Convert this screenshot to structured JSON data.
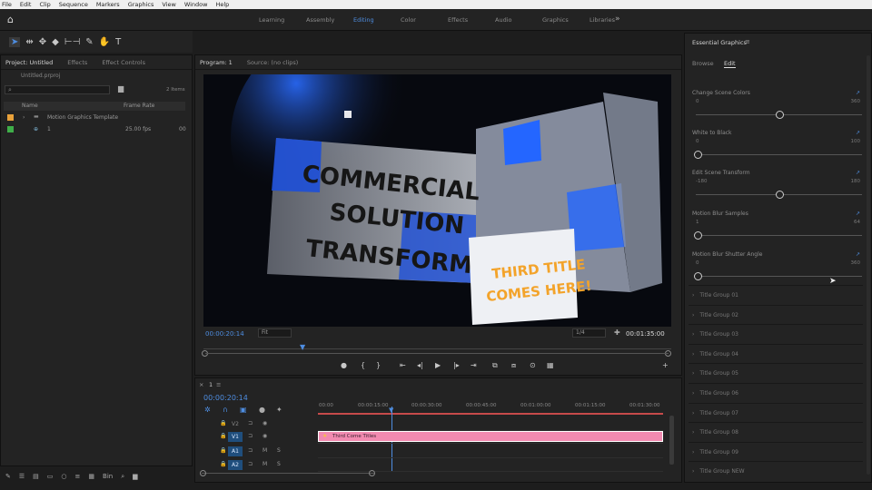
{
  "menu": [
    "File",
    "Edit",
    "Clip",
    "Sequence",
    "Markers",
    "Graphics",
    "View",
    "Window",
    "Help"
  ],
  "workspaces": {
    "tabs": [
      "Learning",
      "Assembly",
      "Editing",
      "Color",
      "Effects",
      "Audio",
      "Graphics",
      "Libraries"
    ],
    "active_index": 2,
    "more_glyph": "»"
  },
  "icons": {
    "home": "⌂",
    "tools": [
      "➤",
      "⇹",
      "✥",
      "◆",
      "⊢⊣",
      "✎",
      "✋",
      "T"
    ]
  },
  "project": {
    "tabs": [
      "Project: Untitled",
      "Effects",
      "Effect Controls"
    ],
    "file_name": "Untitled.prproj",
    "search_glyph": "⌕",
    "items_count": "2 Items",
    "columns": [
      "Name",
      "Frame Rate"
    ],
    "rows": [
      {
        "name": "Motion Graphics Template",
        "rate": "",
        "color": "#e8a13a"
      },
      {
        "name": "1",
        "rate": "25.00 fps",
        "color": "#3fae49"
      }
    ],
    "rate_suffix": "00",
    "bottom_icons": [
      "✎",
      "☰",
      "▤",
      "▭",
      "○",
      "≡",
      "▦",
      "Bin",
      "⌕",
      "▆"
    ]
  },
  "program": {
    "tabs": [
      "Program: 1",
      "Source: (no clips)"
    ],
    "video_text": {
      "line1": "COMMERCIAL",
      "line2": "SOLUTION",
      "line3": "TRANSFORM",
      "third_title_1": "THIRD TITLE",
      "third_title_2": "COMES HERE!"
    },
    "timecode_current": "00:00:20:14",
    "fit_value": "Fit",
    "resolution_value": "1/4",
    "timecode_duration": "00:01:35:00",
    "transport": [
      "●",
      "{",
      "}",
      "⇤",
      "◂|",
      "▶",
      "|▸",
      "⇥",
      "⧉",
      "⧈",
      "⊙",
      "▦",
      "+"
    ]
  },
  "timeline": {
    "tab_label": "1",
    "timecode": "00:00:20:14",
    "ruler": [
      "00:00",
      "00:00:15:00",
      "00:00:30:00",
      "00:00:45:00",
      "00:01:00:00",
      "00:01:15:00",
      "00:01:30:00"
    ],
    "tracks": [
      {
        "name": "V2",
        "highlight": false
      },
      {
        "name": "V1",
        "highlight": true
      },
      {
        "name": "A1",
        "highlight": true
      },
      {
        "name": "A2",
        "highlight": true
      }
    ],
    "clip_label": "Third Come Titles",
    "clip_color": "#f28ab0"
  },
  "essential_graphics": {
    "title": "Essential Graphics",
    "tabs": [
      "Browse",
      "Edit"
    ],
    "active_tab": 1,
    "params": [
      {
        "label": "Change Scene Colors",
        "min": "0",
        "max": "360",
        "value": 0.5
      },
      {
        "label": "White to Black",
        "min": "0",
        "max": "100",
        "value": 0.0
      },
      {
        "label": "Edit Scene Transform",
        "min": "-180",
        "max": "180",
        "value": 0.5
      },
      {
        "label": "Motion Blur Samples",
        "min": "1",
        "max": "64",
        "value": 0.0
      },
      {
        "label": "Motion Blur Shutter Angle",
        "min": "0",
        "max": "360",
        "value": 0.0
      }
    ],
    "groups": [
      "Title Group 01",
      "Title Group 02",
      "Title Group 03",
      "Title Group 04",
      "Title Group 05",
      "Title Group 06",
      "Title Group 07",
      "Title Group 08",
      "Title Group 09",
      "Title Group NEW"
    ]
  },
  "colors": {
    "accent": "#4e8de0",
    "panel": "#232323",
    "clip": "#f28ab0"
  }
}
